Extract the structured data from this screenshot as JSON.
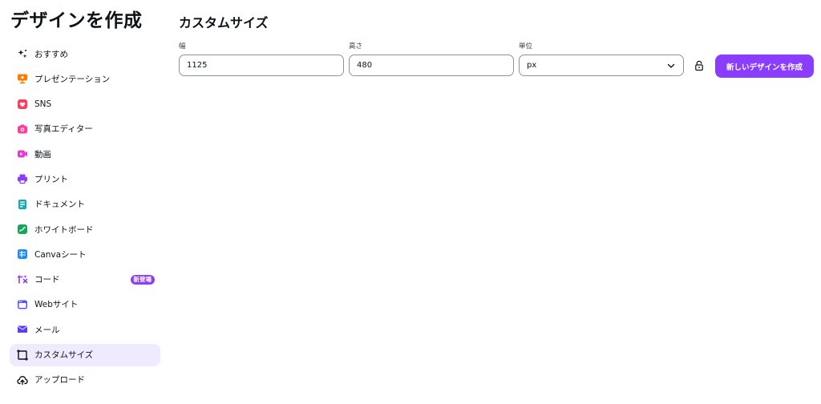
{
  "sidebar": {
    "title": "デザインを作成",
    "items": [
      {
        "label": "おすすめ",
        "icon": "sparkle-icon",
        "color": "#0e1318"
      },
      {
        "label": "プレゼンテーション",
        "icon": "presentation-icon",
        "color": "#ff7a00"
      },
      {
        "label": "SNS",
        "icon": "heart-icon",
        "color": "#ff3b5c"
      },
      {
        "label": "写真エディター",
        "icon": "camera-icon",
        "color": "#ff3b9d"
      },
      {
        "label": "動画",
        "icon": "video-icon",
        "color": "#e23cd6"
      },
      {
        "label": "プリント",
        "icon": "printer-icon",
        "color": "#8b3dff"
      },
      {
        "label": "ドキュメント",
        "icon": "document-icon",
        "color": "#13a8b8"
      },
      {
        "label": "ホワイトボード",
        "icon": "whiteboard-icon",
        "color": "#19a35b"
      },
      {
        "label": "Canvaシート",
        "icon": "sheet-icon",
        "color": "#1f8cf0"
      },
      {
        "label": "コード",
        "icon": "code-icon",
        "color": "#8b3dff",
        "badge": "新登場"
      },
      {
        "label": "Webサイト",
        "icon": "website-icon",
        "color": "#5a55f5"
      },
      {
        "label": "メール",
        "icon": "mail-icon",
        "color": "#5a3df5"
      },
      {
        "label": "カスタムサイズ",
        "icon": "custom-size-icon",
        "color": "#0e1318",
        "active": true
      },
      {
        "label": "アップロード",
        "icon": "upload-cloud-icon",
        "color": "#0e1318"
      }
    ]
  },
  "main": {
    "title": "カスタムサイズ",
    "width": {
      "label": "幅",
      "value": "1125"
    },
    "height": {
      "label": "高さ",
      "value": "480"
    },
    "unit": {
      "label": "単位",
      "value": "px"
    },
    "create_button": "新しいデザインを作成"
  },
  "colors": {
    "accent": "#8b3dff",
    "active_bg": "#efeafe"
  }
}
